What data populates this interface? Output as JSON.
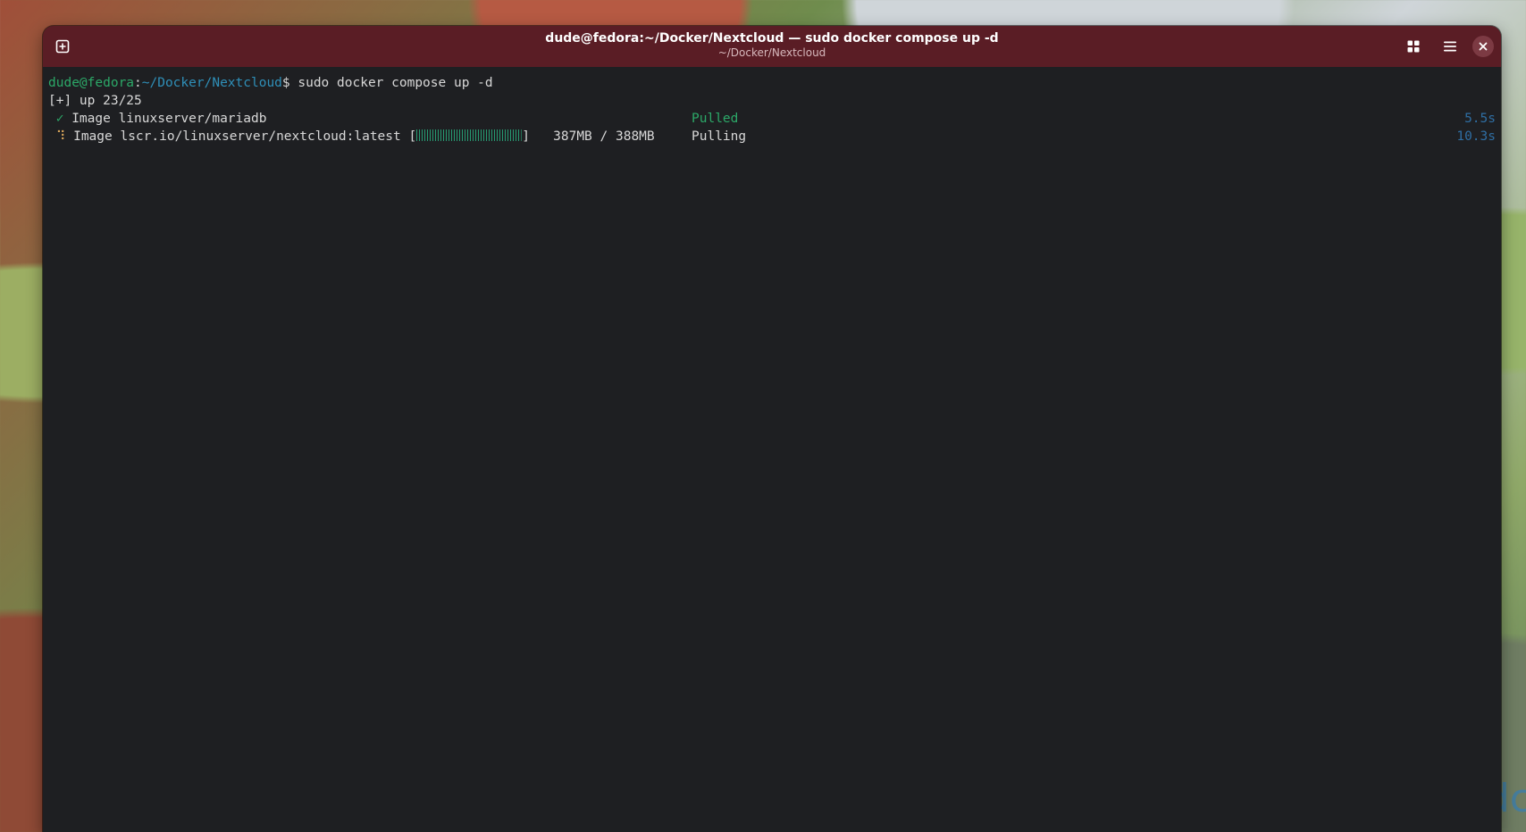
{
  "window": {
    "title": "dude@fedora:~/Docker/Nextcloud — sudo docker compose up -d",
    "subtitle": "~/Docker/Nextcloud"
  },
  "wallpaper": {
    "corner_text": "dc"
  },
  "icons": {
    "new_tab": "new-tab-icon",
    "view": "grid-icon",
    "menu": "hamburger-menu-icon",
    "close": "close-icon"
  },
  "colors": {
    "titlebar": "#5a1d25",
    "terminal_bg": "#1e1f22",
    "prompt_green": "#2ca868",
    "path_blue": "#2f8fb8",
    "progress_green": "#28a87a"
  },
  "terminal": {
    "prompt": {
      "user_host": "dude@fedora",
      "sep": ":",
      "path": "~/Docker/Nextcloud",
      "symbol": "$",
      "command": " sudo docker compose up -d"
    },
    "summary": "[+] up 23/25",
    "rows": [
      {
        "marker": "✓",
        "label": "Image linuxserver/mariadb",
        "status": "Pulled",
        "time": "5.5s"
      },
      {
        "marker": "⠹",
        "label": "Image lscr.io/linuxserver/nextcloud:latest",
        "bar_open": " [",
        "bar_close": "]",
        "progress_fraction": 0.997,
        "size": "   387MB / 388MB",
        "status": "Pulling",
        "time": "10.3s"
      }
    ]
  }
}
